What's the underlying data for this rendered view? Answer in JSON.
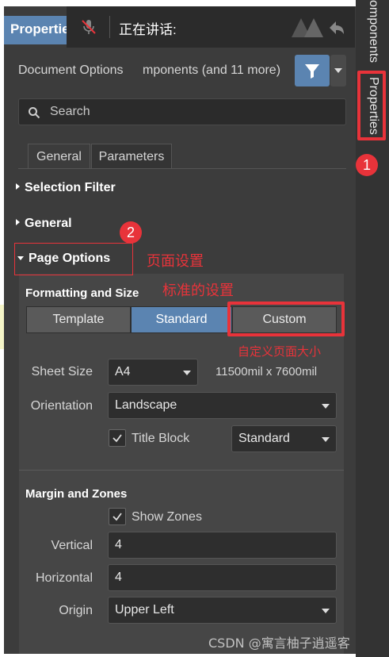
{
  "panel": {
    "title": "Properties",
    "speaking_overlay": {
      "text": "正在讲话:",
      "mic_icon": "mic-muted-icon",
      "logo_icon": "app-logo-icon"
    },
    "doc_options_label": "Document Options",
    "components_label": "mponents (and 11 more)",
    "filter_icon": "filter-icon",
    "search": {
      "placeholder": "Search",
      "icon": "search-icon"
    },
    "tabs": [
      {
        "label": "General"
      },
      {
        "label": "Parameters"
      }
    ],
    "sections": {
      "selection_filter": "Selection Filter",
      "general": "General",
      "page_options": "Page Options"
    },
    "formatting": {
      "title": "Formatting and Size",
      "modes": [
        {
          "label": "Template"
        },
        {
          "label": "Standard",
          "selected": true
        },
        {
          "label": "Custom"
        }
      ],
      "sheet_size_label": "Sheet Size",
      "sheet_size_value": "A4",
      "dimensions": "11500mil  x  7600mil",
      "orientation_label": "Orientation",
      "orientation_value": "Landscape",
      "title_block_label": "Title Block",
      "title_block_checked": true,
      "title_block_value": "Standard"
    },
    "margins": {
      "title": "Margin and Zones",
      "show_zones_label": "Show Zones",
      "show_zones_checked": true,
      "vertical_label": "Vertical",
      "vertical_value": "4",
      "horizontal_label": "Horizontal",
      "horizontal_value": "4",
      "origin_label": "Origin",
      "origin_value": "Upper Left"
    }
  },
  "side_rail": {
    "components_label": "omponents",
    "properties_label": "Properties"
  },
  "annotations": {
    "badge1": "1",
    "badge2": "2",
    "page_settings": "页面设置",
    "standard_settings": "标准的设置",
    "custom_page_size": "自定义页面大小"
  },
  "watermark": "CSDN @寓言柚子逍遥客",
  "colors": {
    "accent": "#5b84b1",
    "panel_bg": "#3c3c3c",
    "annotation_red": "#e8333a"
  }
}
